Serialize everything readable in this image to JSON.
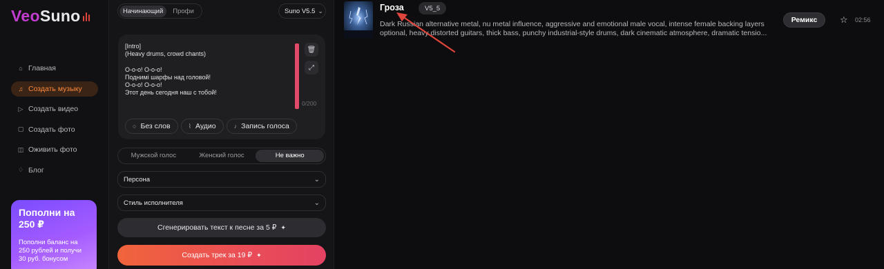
{
  "brand": {
    "name_part1": "Veo",
    "name_part2": "Suno"
  },
  "sidebar": {
    "items": [
      {
        "label": "Главная",
        "icon": "home-icon",
        "active": false
      },
      {
        "label": "Создать музыку",
        "icon": "music-note-icon",
        "active": true
      },
      {
        "label": "Создать видео",
        "icon": "video-icon",
        "active": false
      },
      {
        "label": "Создать фото",
        "icon": "photo-icon",
        "active": false
      },
      {
        "label": "Оживить фото",
        "icon": "animate-photo-icon",
        "active": false
      },
      {
        "label": "Блог",
        "icon": "bell-icon",
        "active": false
      }
    ],
    "promo": {
      "title": "Пополни на 250 ₽",
      "text": "Пополни баланс на 250 рублей и получи 30 руб. бонусом"
    }
  },
  "panel": {
    "modes": [
      {
        "label": "Начинающий",
        "active": true
      },
      {
        "label": "Профи",
        "active": false
      }
    ],
    "model": "Suno V5.5",
    "lyrics": "[Intro]\n(Heavy drums, crowd chants)\n\nО-о-о! О-о-о!\nПоднимi шарфы над головой!\nО-о-о! О-о-о!\nЭтот день сегодня наш с тобой!",
    "char_counter": "0/200",
    "chips": {
      "no_words": "Без слов",
      "audio": "Аудио",
      "voice_record": "Запись голоса"
    },
    "voice_options": [
      {
        "label": "Мужской голос",
        "active": false
      },
      {
        "label": "Женский голос",
        "active": false
      },
      {
        "label": "Не важно",
        "active": true
      }
    ],
    "persona_label": "Персона",
    "style_label": "Стиль исполнителя",
    "generate_text_label": "Сгенерировать текст к песне за 5 ₽",
    "create_track_label": "Создать трек за 19 ₽"
  },
  "track": {
    "title": "Гроза",
    "version": "V5_5",
    "description": "Dark Russian alternative metal, nu metal influence, aggressive and emotional male vocal, intense female backing layers optional, heavy distorted guitars, thick bass, punchy industrial-style drums, dark cinematic atmosphere, dramatic tensio...",
    "remix_label": "Ремикс",
    "duration": "02:56"
  },
  "colors": {
    "accent": "#ff8a3d",
    "brand_purple": "#c23ccf",
    "create_gradient_start": "#f0643b",
    "create_gradient_end": "#e34262",
    "annotation_arrow": "#e0453c"
  }
}
